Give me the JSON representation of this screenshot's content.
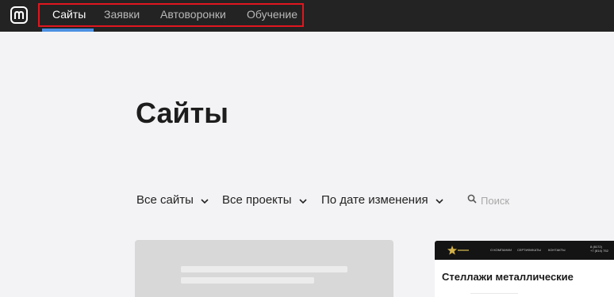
{
  "topbar": {
    "logo_icon": "m-logo-icon",
    "nav": [
      {
        "label": "Сайты",
        "active": true
      },
      {
        "label": "Заявки",
        "active": false
      },
      {
        "label": "Автоворонки",
        "active": false
      },
      {
        "label": "Обучение",
        "active": false
      }
    ],
    "highlight_color": "#e0161e",
    "active_underline_color": "#4a90e2"
  },
  "main": {
    "title": "Сайты",
    "filters": [
      {
        "label": "Все сайты",
        "icon": "chevron-down-icon"
      },
      {
        "label": "Все проекты",
        "icon": "chevron-down-icon"
      },
      {
        "label": "По дате изменения",
        "icon": "chevron-down-icon"
      }
    ],
    "search": {
      "placeholder": "Поиск",
      "icon": "search-icon"
    }
  },
  "site_card": {
    "headline": "Стеллажи металлические",
    "nav": [
      "О КОМПАНИИ",
      "СЕРТИФИКАТЫ",
      "КОНТАКТЫ"
    ],
    "phone_lines": [
      "8 (8172)",
      "+7 (814) 752"
    ]
  }
}
